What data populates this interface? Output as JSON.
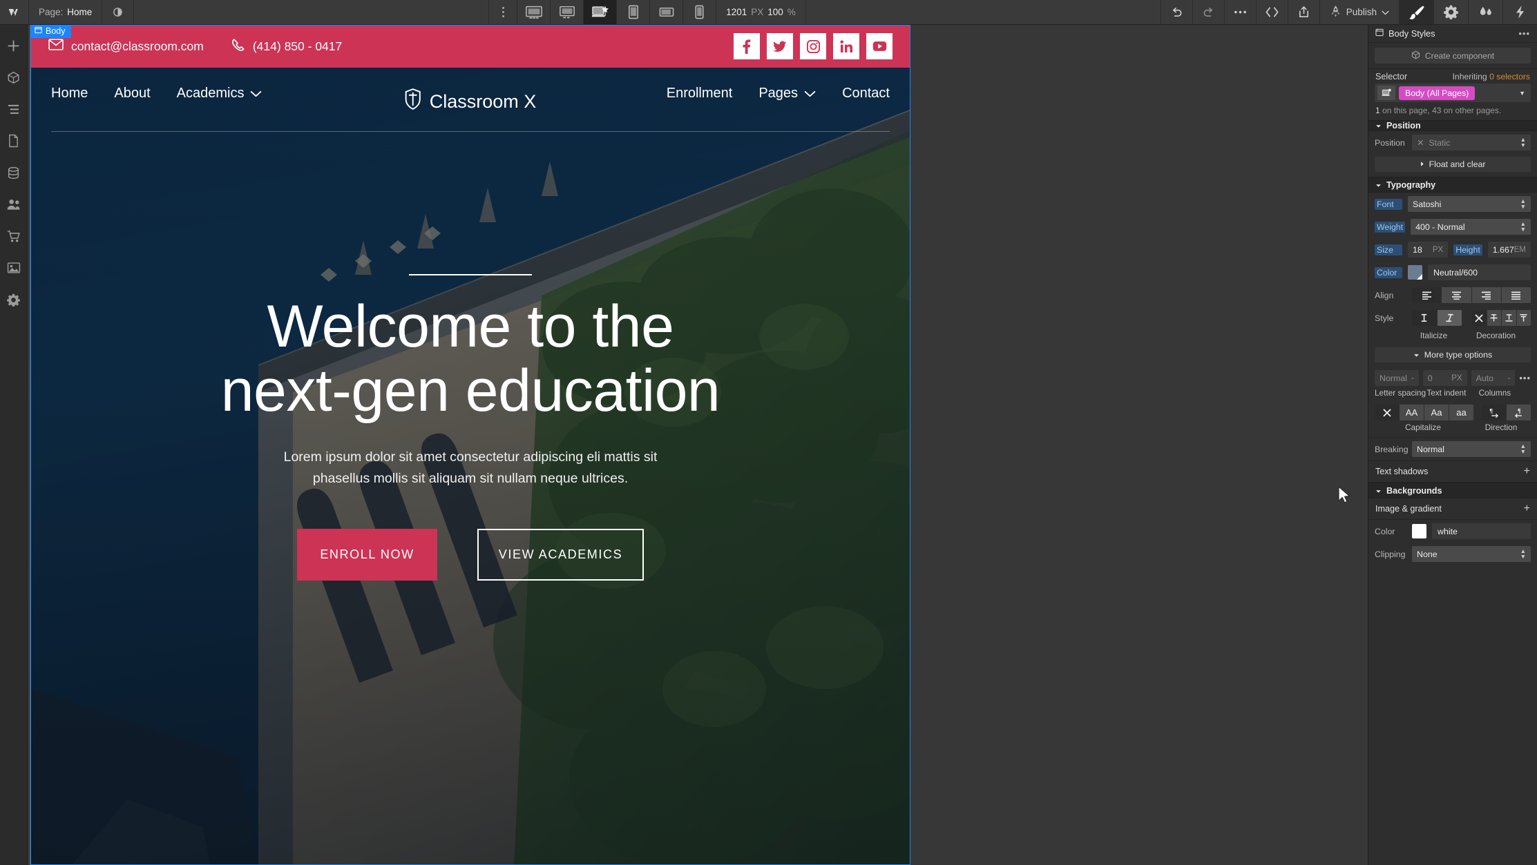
{
  "topbar": {
    "logo_icon": "webflow-logo-icon",
    "page_key": "Page:",
    "page_value": "Home",
    "eye_icon": "preview-eye-icon",
    "kebab_icon": "more-options-vertical-icon",
    "breakpoints": [
      {
        "name": "breakpoint-desktop-xl",
        "icon": "monitor-icon",
        "active": false
      },
      {
        "name": "breakpoint-desktop",
        "icon": "monitor-icon",
        "active": false
      },
      {
        "name": "breakpoint-base",
        "icon": "laptop-star-icon",
        "active": true
      },
      {
        "name": "breakpoint-tablet",
        "icon": "tablet-icon",
        "active": false
      },
      {
        "name": "breakpoint-mobile-landscape",
        "icon": "phone-landscape-icon",
        "active": false
      },
      {
        "name": "breakpoint-mobile-portrait",
        "icon": "phone-portrait-icon",
        "active": false
      }
    ],
    "canvas_width": "1201",
    "canvas_width_unit": "PX",
    "zoom_value": "100",
    "zoom_unit": "%",
    "undo_icon": "undo-arrow-icon",
    "redo_icon": "redo-arrow-icon",
    "ellipsis_icon": "horizontal-ellipsis-icon",
    "code_icon": "code-brackets-icon",
    "share_icon": "share-export-icon",
    "publish_icon": "rocket-icon",
    "publish_label": "Publish",
    "publish_chevron": "chevron-down-icon",
    "right_tools": [
      {
        "name": "style-panel-button",
        "icon": "paintbrush-icon",
        "active": true
      },
      {
        "name": "settings-panel-button",
        "icon": "gear-icon",
        "active": false
      },
      {
        "name": "interactions-panel-button",
        "icon": "water-drops-icon",
        "active": false
      },
      {
        "name": "variables-panel-button",
        "icon": "lightning-bolt-icon",
        "active": false
      }
    ]
  },
  "left_rail": [
    {
      "name": "rail-add-elements",
      "icon": "plus-icon"
    },
    {
      "name": "rail-components",
      "icon": "cube-icon"
    },
    {
      "name": "rail-navigator",
      "icon": "layers-list-icon"
    },
    {
      "name": "rail-pages",
      "icon": "page-icon"
    },
    {
      "name": "rail-cms",
      "icon": "database-icon"
    },
    {
      "name": "rail-users",
      "icon": "users-icon"
    },
    {
      "name": "rail-ecommerce",
      "icon": "shopping-cart-icon"
    },
    {
      "name": "rail-assets",
      "icon": "image-icon"
    },
    {
      "name": "rail-settings",
      "icon": "gear-icon"
    }
  ],
  "canvas": {
    "body_badge": "Body",
    "body_badge_icon": "body-element-icon",
    "site": {
      "topbar": {
        "email": "contact@classroom.com",
        "email_icon": "envelope-icon",
        "phone": "(414) 850 - 0417",
        "phone_icon": "phone-icon",
        "bg_color": "#cc3355",
        "socials": [
          {
            "name": "social-facebook",
            "glyph": "f"
          },
          {
            "name": "social-twitter",
            "glyph": "t"
          },
          {
            "name": "social-instagram",
            "glyph": "i"
          },
          {
            "name": "social-linkedin",
            "glyph": "in"
          },
          {
            "name": "social-youtube",
            "glyph": "yt"
          }
        ]
      },
      "nav": {
        "brand": "Classroom X",
        "brand_icon": "shield-logo-icon",
        "left_links": [
          {
            "label": "Home",
            "dropdown": false
          },
          {
            "label": "About",
            "dropdown": false
          },
          {
            "label": "Academics",
            "dropdown": true
          }
        ],
        "right_links": [
          {
            "label": "Enrollment",
            "dropdown": false
          },
          {
            "label": "Pages",
            "dropdown": true
          },
          {
            "label": "Contact",
            "dropdown": false
          }
        ]
      },
      "hero": {
        "heading_line1": "Welcome to the",
        "heading_line2": "next-gen education",
        "paragraph_line1": "Lorem ipsum dolor sit amet consectetur adipiscing eli mattis sit",
        "paragraph_line2": "phasellus mollis sit aliquam sit nullam neque ultrices.",
        "primary_button": "ENROLL NOW",
        "secondary_button": "VIEW ACADEMICS"
      }
    }
  },
  "panel": {
    "title": "Body Styles",
    "title_icon": "body-element-icon",
    "more_icon": "horizontal-ellipsis-icon",
    "create_component": "Create component",
    "create_component_icon": "cube-icon",
    "selector_label": "Selector",
    "inheriting_prefix": "Inheriting",
    "inheriting_count": "0 selectors",
    "selector_tag": "Body (All Pages)",
    "selector_icon": "breakpoint-base-icon",
    "selector_chevron": "chevron-down-icon",
    "selector_note_count": "1",
    "selector_note_rest": " on this page, 43 on other pages.",
    "position": {
      "section_title": "Position",
      "label": "Position",
      "clear_icon": "x-icon",
      "value": "Static",
      "float_and_clear": "Float and clear",
      "float_chevron": "chevron-right-icon"
    },
    "typography": {
      "section_title": "Typography",
      "font_label": "Font",
      "font_value": "Satoshi",
      "weight_label": "Weight",
      "weight_value": "400 - Normal",
      "size_label": "Size",
      "size_value": "18",
      "size_unit": "PX",
      "height_label": "Height",
      "height_value": "1.667",
      "height_unit": "EM",
      "color_label": "Color",
      "color_value": "Neutral/600",
      "color_swatch": "#6c7d92",
      "align_label": "Align",
      "align_options": [
        "align-left-icon",
        "align-center-icon",
        "align-right-icon",
        "align-justify-icon"
      ],
      "align_active_index": 0,
      "style_label": "Style",
      "style_upright_icon": "text-upright-icon",
      "style_italic_icon": "text-italic-icon",
      "italicize_label": "Italicize",
      "decoration_label": "Decoration",
      "decoration_options": [
        "decoration-none-x-icon",
        "strikethrough-icon",
        "underline-icon",
        "overline-icon"
      ],
      "more_type_options": "More type options",
      "more_chevron": "chevron-down-icon",
      "letter_spacing_value": "Normal",
      "letter_spacing_unit": "-",
      "letter_spacing_label": "Letter spacing",
      "text_indent_value": "0",
      "text_indent_unit": "PX",
      "text_indent_label": "Text indent",
      "columns_value": "Auto",
      "columns_unit": "-",
      "columns_label": "Columns",
      "columns_more_icon": "horizontal-ellipsis-icon",
      "capitalize_label": "Capitalize",
      "capitalize_options": [
        "none-x-icon",
        "uppercase-AA-icon",
        "capitalize-Aa-icon",
        "lowercase-aa-icon"
      ],
      "direction_label": "Direction",
      "direction_options": [
        "direction-ltr-icon",
        "direction-rtl-icon"
      ],
      "breaking_label": "Breaking",
      "breaking_value": "Normal",
      "text_shadows_label": "Text shadows",
      "text_shadows_plus": "+"
    },
    "backgrounds": {
      "section_title": "Backgrounds",
      "image_gradient_label": "Image & gradient",
      "image_gradient_plus": "+",
      "color_label": "Color",
      "color_value": "white",
      "color_swatch": "#ffffff",
      "clipping_label": "Clipping",
      "clipping_value": "None"
    }
  },
  "colors": {
    "accent_pink": "#d64bc4",
    "site_red": "#cc3355",
    "selection_blue": "#1a86ff",
    "inherit_orange": "#d98a3a"
  }
}
